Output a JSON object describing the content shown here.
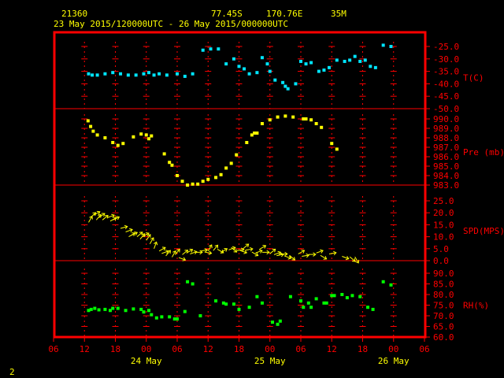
{
  "header": {
    "station": "21360",
    "lat": "77.45S",
    "lon": "170.76E",
    "elev": "35M",
    "time_range": "23 May 2015/120000UTC - 26 May 2015/000000UTC"
  },
  "footer": {
    "page_number": "2"
  },
  "colors": {
    "frame": "#ff0000",
    "grid": "#ff0000",
    "temperature": "#00e5ff",
    "pressure": "#ffff00",
    "wind": "#ffff00",
    "humidity": "#00ff00",
    "text": "#ffff00"
  },
  "chart_data": {
    "type": "scatter",
    "x_axis": {
      "unit": "hours since 23 May 2015 06UTC",
      "range": [
        0,
        72
      ],
      "tick_labels": [
        "06",
        "12",
        "18",
        "00",
        "06",
        "12",
        "18",
        "00",
        "06",
        "12",
        "18",
        "00",
        "06"
      ],
      "day_labels": [
        {
          "label": "24 May",
          "hour": 18
        },
        {
          "label": "25 May",
          "hour": 42
        },
        {
          "label": "26 May",
          "hour": 66
        }
      ]
    },
    "panels": [
      {
        "id": "temperature",
        "label": "T(C)",
        "ylim": [
          -50,
          -25
        ],
        "ticks": [
          -25,
          -30,
          -35,
          -40,
          -45,
          -50
        ],
        "tick_labels": [
          "-25.0",
          "-30.0",
          "-35.0",
          "-40.0",
          "-45.0",
          "-50.0"
        ],
        "points": [
          [
            6.8,
            -36
          ],
          [
            7.5,
            -36.5
          ],
          [
            8.5,
            -36.5
          ],
          [
            10,
            -36
          ],
          [
            11.5,
            -35.5
          ],
          [
            13,
            -36
          ],
          [
            14.5,
            -36.5
          ],
          [
            16,
            -36.5
          ],
          [
            17.5,
            -36
          ],
          [
            18.5,
            -35.5
          ],
          [
            19.5,
            -36.5
          ],
          [
            20.5,
            -36
          ],
          [
            22,
            -36.5
          ],
          [
            24,
            -36
          ],
          [
            25.5,
            -37
          ],
          [
            27,
            -36
          ],
          [
            29,
            -26.5
          ],
          [
            30.5,
            -26
          ],
          [
            32,
            -26
          ],
          [
            33.5,
            -32
          ],
          [
            35,
            -30
          ],
          [
            36,
            -33
          ],
          [
            37,
            -34
          ],
          [
            38,
            -36
          ],
          [
            39.5,
            -35.5
          ],
          [
            40.5,
            -29.5
          ],
          [
            41.5,
            -32
          ],
          [
            42,
            -35
          ],
          [
            43,
            -38.5
          ],
          [
            44.5,
            -39.5
          ],
          [
            45,
            -41
          ],
          [
            45.5,
            -42
          ],
          [
            47,
            -40
          ],
          [
            48,
            -31
          ],
          [
            49,
            -32
          ],
          [
            50,
            -31.5
          ],
          [
            51.5,
            -35
          ],
          [
            52.5,
            -34.5
          ],
          [
            53.5,
            -33.5
          ],
          [
            55,
            -30.5
          ],
          [
            56.5,
            -31
          ],
          [
            57.5,
            -30.5
          ],
          [
            58.5,
            -29
          ],
          [
            59.5,
            -31
          ],
          [
            60.5,
            -30.5
          ],
          [
            61.5,
            -33
          ],
          [
            62.5,
            -33.5
          ],
          [
            64,
            -24.5
          ],
          [
            65.5,
            -25
          ]
        ]
      },
      {
        "id": "pressure",
        "label": "Pre (mb)",
        "ylim": [
          983,
          990
        ],
        "ticks": [
          990,
          989,
          988,
          987,
          986,
          985,
          984,
          983
        ],
        "tick_labels": [
          "990.0",
          "989.0",
          "988.0",
          "987.0",
          "986.0",
          "985.0",
          "984.0",
          "983.0"
        ],
        "points": [
          [
            6.7,
            989.8
          ],
          [
            7.2,
            989.2
          ],
          [
            7.7,
            988.7
          ],
          [
            8.5,
            988.3
          ],
          [
            10,
            988
          ],
          [
            11.5,
            987.5
          ],
          [
            12.5,
            987.2
          ],
          [
            13.5,
            987.4
          ],
          [
            15.5,
            988.1
          ],
          [
            17,
            988.4
          ],
          [
            18,
            988.3
          ],
          [
            18.5,
            987.9
          ],
          [
            19,
            988.2
          ],
          [
            21.5,
            986.3
          ],
          [
            22.5,
            985.4
          ],
          [
            23,
            985.1
          ],
          [
            24,
            984
          ],
          [
            25,
            983.4
          ],
          [
            26,
            983
          ],
          [
            27,
            983.1
          ],
          [
            28,
            983.1
          ],
          [
            29,
            983.4
          ],
          [
            30,
            983.6
          ],
          [
            31.5,
            983.8
          ],
          [
            32.5,
            984.1
          ],
          [
            33.5,
            984.8
          ],
          [
            34.5,
            985.3
          ],
          [
            35.5,
            986.2
          ],
          [
            37.5,
            987.5
          ],
          [
            38.5,
            988.3
          ],
          [
            39,
            988.5
          ],
          [
            39.5,
            988.5
          ],
          [
            40.5,
            989.5
          ],
          [
            42,
            989.9
          ],
          [
            43.5,
            990.2
          ],
          [
            45,
            990.3
          ],
          [
            46.5,
            990.2
          ],
          [
            48.5,
            990
          ],
          [
            49,
            990
          ],
          [
            50,
            989.9
          ],
          [
            51,
            989.5
          ],
          [
            52,
            989.1
          ],
          [
            54,
            987.4
          ],
          [
            55,
            986.8
          ]
        ]
      },
      {
        "id": "wind",
        "label": "SPD(MPS)",
        "ylim": [
          0,
          25
        ],
        "ticks": [
          0,
          5,
          10,
          15,
          20,
          25
        ],
        "tick_labels": [
          "0.0",
          "5.0",
          "10.0",
          "15.0",
          "20.0",
          "25.0"
        ],
        "vectors": [
          [
            6.8,
            16,
            60
          ],
          [
            7.2,
            18,
            45
          ],
          [
            7.8,
            19,
            30
          ],
          [
            8.3,
            17,
            50
          ],
          [
            8.8,
            18,
            35
          ],
          [
            9.5,
            17,
            40
          ],
          [
            10.5,
            18,
            20
          ],
          [
            11,
            16.5,
            30
          ],
          [
            11.5,
            17,
            25
          ],
          [
            13,
            13.5,
            15
          ],
          [
            14,
            12,
            20
          ],
          [
            14.6,
            10,
            30
          ],
          [
            15,
            10.5,
            25
          ],
          [
            16.2,
            10,
            40
          ],
          [
            16.8,
            9,
            50
          ],
          [
            17.3,
            10,
            30
          ],
          [
            18,
            8.5,
            55
          ],
          [
            18.7,
            7,
            60
          ],
          [
            19.5,
            5,
            70
          ],
          [
            20.5,
            4,
            30
          ],
          [
            21,
            3,
            20
          ],
          [
            21.8,
            2,
            50
          ],
          [
            23,
            1.5,
            60
          ],
          [
            23.6,
            2.5,
            50
          ],
          [
            24.3,
            1.3,
            -20
          ],
          [
            25,
            2.5,
            40
          ],
          [
            25.8,
            3.2,
            30
          ],
          [
            26.5,
            2.8,
            20
          ],
          [
            27.5,
            3.5,
            0
          ],
          [
            28.5,
            4,
            10
          ],
          [
            29.3,
            3.6,
            -10
          ],
          [
            30,
            4,
            60
          ],
          [
            31,
            4.2,
            50
          ],
          [
            31.8,
            4.8,
            -30
          ],
          [
            32.5,
            3.5,
            30
          ],
          [
            34,
            4.5,
            20
          ],
          [
            34.5,
            5.5,
            -40
          ],
          [
            35.6,
            4.2,
            10
          ],
          [
            36.2,
            4.3,
            -20
          ],
          [
            36.8,
            5,
            40
          ],
          [
            37.3,
            4.4,
            10
          ],
          [
            38.5,
            3.6,
            -30
          ],
          [
            39.2,
            3.2,
            20
          ],
          [
            40,
            4.8,
            30
          ],
          [
            40.5,
            3.5,
            0
          ],
          [
            42,
            2.9,
            40
          ],
          [
            42.8,
            2.5,
            20
          ],
          [
            43.3,
            2.1,
            10
          ],
          [
            44,
            2.8,
            0
          ],
          [
            44.8,
            2,
            -20
          ],
          [
            45.8,
            2.2,
            -40
          ],
          [
            47.5,
            2.8,
            30
          ],
          [
            48.2,
            1.8,
            10
          ],
          [
            49.5,
            2.6,
            0
          ],
          [
            51,
            3.2,
            20
          ],
          [
            51.8,
            2.2,
            -30
          ],
          [
            53.5,
            2.8,
            10
          ],
          [
            56,
            1.8,
            -20
          ],
          [
            57.5,
            1.6,
            -40
          ],
          [
            58.5,
            1.6,
            -60
          ]
        ]
      },
      {
        "id": "humidity",
        "label": "RH(%)",
        "ylim": [
          60,
          90
        ],
        "ticks": [
          90,
          85,
          80,
          75,
          70,
          65,
          60
        ],
        "tick_labels": [
          "90.0",
          "85.0",
          "80.0",
          "75.0",
          "70.0",
          "65.0",
          "60.0"
        ],
        "points": [
          [
            6.8,
            72.5
          ],
          [
            7.3,
            73
          ],
          [
            8,
            73.5
          ],
          [
            8.8,
            72.8
          ],
          [
            10,
            73
          ],
          [
            11,
            72.5
          ],
          [
            11.5,
            73.5
          ],
          [
            12.5,
            73.5
          ],
          [
            14,
            72.5
          ],
          [
            15.5,
            73.2
          ],
          [
            17,
            73
          ],
          [
            17.5,
            71.8
          ],
          [
            18.5,
            72.5
          ],
          [
            19,
            70.5
          ],
          [
            20,
            69
          ],
          [
            21,
            69.5
          ],
          [
            22.5,
            69.5
          ],
          [
            23.5,
            68.5
          ],
          [
            24,
            68.5
          ],
          [
            25.5,
            72
          ],
          [
            26,
            86
          ],
          [
            27,
            85
          ],
          [
            28.5,
            70
          ],
          [
            31.5,
            77
          ],
          [
            33,
            76
          ],
          [
            33.5,
            75.5
          ],
          [
            35,
            75.5
          ],
          [
            36,
            73
          ],
          [
            38,
            74
          ],
          [
            39.5,
            79
          ],
          [
            40.5,
            76
          ],
          [
            42.5,
            67
          ],
          [
            43.5,
            66
          ],
          [
            44,
            67.5
          ],
          [
            46,
            79
          ],
          [
            48,
            77
          ],
          [
            48.5,
            74
          ],
          [
            49.5,
            76
          ],
          [
            50,
            74
          ],
          [
            51,
            78
          ],
          [
            52.5,
            76
          ],
          [
            53,
            76
          ],
          [
            54,
            79.5
          ],
          [
            54.5,
            79.5
          ],
          [
            56,
            80
          ],
          [
            57,
            78.5
          ],
          [
            58,
            79.5
          ],
          [
            59.5,
            79
          ],
          [
            61,
            74
          ],
          [
            62,
            73
          ],
          [
            64,
            86
          ],
          [
            65.5,
            84.5
          ]
        ]
      }
    ]
  }
}
